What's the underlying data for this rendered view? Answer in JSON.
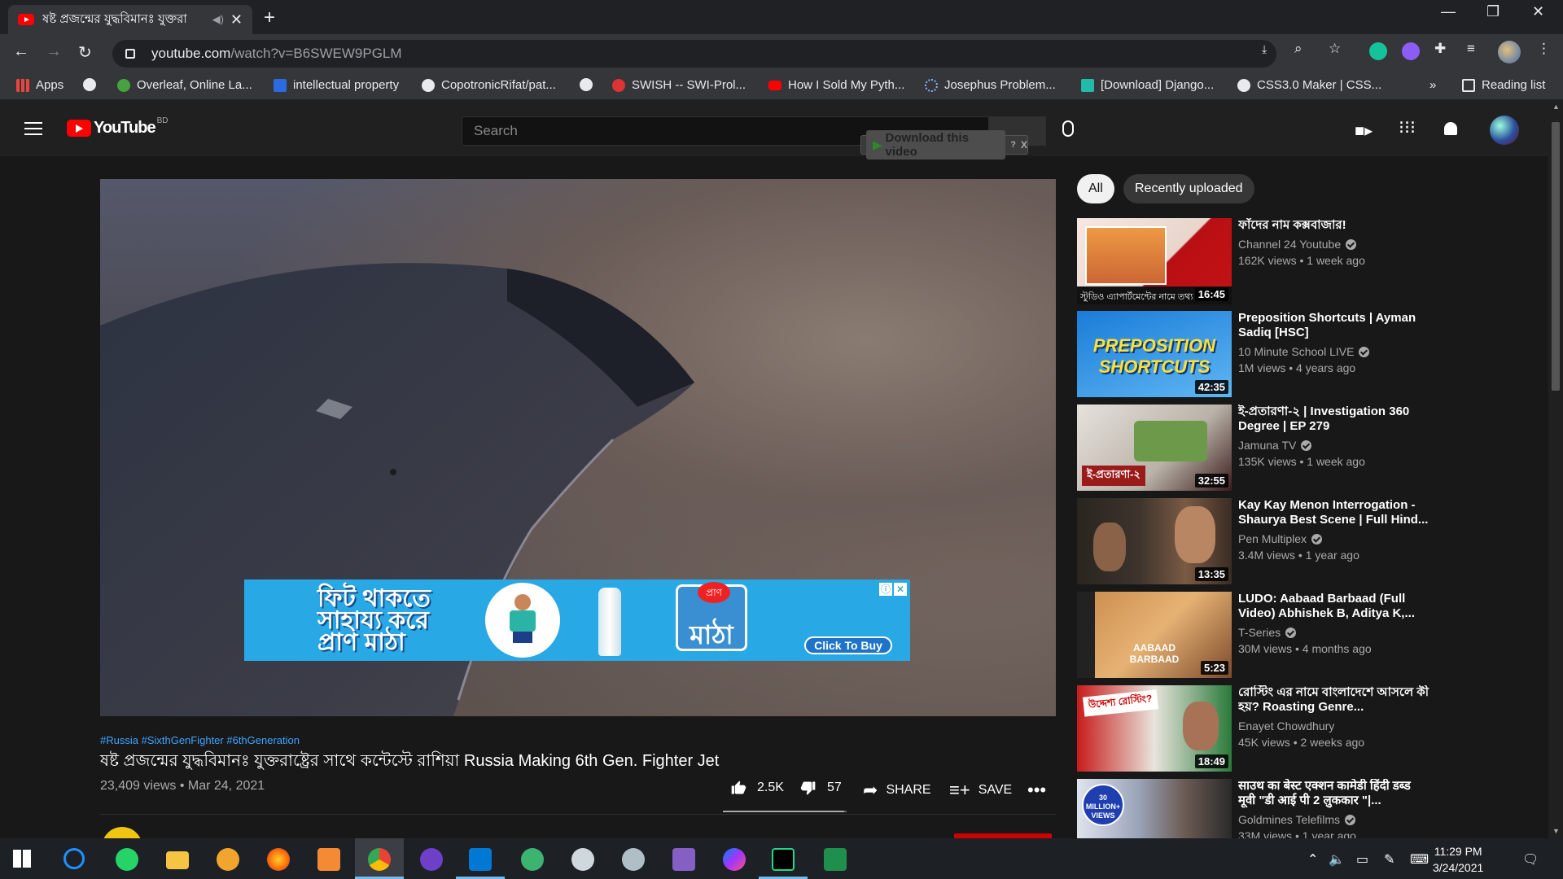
{
  "browser": {
    "tab_title": "ষষ্ট প্রজন্মের যুদ্ধবিমানঃ যুক্তরা",
    "url_host": "youtube.com",
    "url_path": "/watch?v=B6SWEW9PGLM",
    "bookmarks": [
      {
        "label": "Apps",
        "icon": "apps-grid-icon",
        "color": "#e8453c"
      },
      {
        "label": "",
        "icon": "globe-icon",
        "color": "#e8eaed"
      },
      {
        "label": "Overleaf, Online La...",
        "icon": "overleaf-icon",
        "color": "#47a141"
      },
      {
        "label": "intellectual property",
        "icon": "s-icon",
        "color": "#2b6be0"
      },
      {
        "label": "CopotronicRifat/pat...",
        "icon": "github-icon",
        "color": "#e8eaed"
      },
      {
        "label": "",
        "icon": "globe-icon",
        "color": "#e8eaed"
      },
      {
        "label": "SWISH -- SWI-Prol...",
        "icon": "swish-icon",
        "color": "#d33"
      },
      {
        "label": "How I Sold My Pyth...",
        "icon": "youtube-icon",
        "color": "#ff0000"
      },
      {
        "label": "Josephus Problem...",
        "icon": "loading-icon",
        "color": "#8ab4f8"
      },
      {
        "label": "[Download] Django...",
        "icon": "django-icon",
        "color": "#2ba"
      },
      {
        "label": "CSS3.0 Maker | CSS...",
        "icon": "globe-icon",
        "color": "#e8eaed"
      }
    ],
    "overflow": "»",
    "reading_list": "Reading list"
  },
  "youtube": {
    "region": "BD",
    "search_placeholder": "Search",
    "download_label": "Download this video",
    "download_help": "?",
    "download_close": "X",
    "chips": [
      "All",
      "Recently uploaded"
    ],
    "video": {
      "hashtags": "#Russia #SixthGenFighter #6thGeneration",
      "title": "ষষ্ট প্রজন্মের যুদ্ধবিমানঃ যুক্তরাষ্ট্রের সাথে কন্টেস্টে রাশিয়া Russia Making 6th Gen. Fighter Jet",
      "views_date": "23,409 views • Mar 24, 2021",
      "likes": "2.5K",
      "dislikes": "57",
      "share": "SHARE",
      "save": "SAVE",
      "like_ratio": 0.98
    },
    "ad": {
      "line1": "ফিট থাকতে",
      "line2": "সাহায্য করে",
      "line3": "প্রাণ মাঠা",
      "brand": "প্রাণ",
      "product": "মাঠা",
      "cta": "Click To Buy"
    },
    "related": [
      {
        "title": "ফাঁদের নাম কক্সবাজার!",
        "channel": "Channel 24 Youtube",
        "verified": true,
        "meta": "162K views • 1 week ago",
        "duration": "16:45",
        "thumb_text": "স্টুডিও এ্যাপার্টমেন্টের নামে তথ্য"
      },
      {
        "title": "Preposition Shortcuts | Ayman Sadiq [HSC]",
        "channel": "10 Minute School LIVE",
        "verified": true,
        "meta": "1M views • 4 years ago",
        "duration": "42:35",
        "thumb_text": "PREPOSITION SHORTCUTS"
      },
      {
        "title": "ই-প্রতারণা-২ | Investigation 360 Degree | EP 279",
        "channel": "Jamuna TV",
        "verified": true,
        "meta": "135K views • 1 week ago",
        "duration": "32:55",
        "thumb_text": "ই-প্রতারণা-২"
      },
      {
        "title": "Kay Kay Menon Interrogation - Shaurya Best Scene | Full Hind...",
        "channel": "Pen Multiplex",
        "verified": true,
        "meta": "3.4M views • 1 year ago",
        "duration": "13:35",
        "thumb_text": ""
      },
      {
        "title": "LUDO: Aabaad Barbaad (Full Video) Abhishek B, Aditya K,...",
        "channel": "T-Series",
        "verified": true,
        "meta": "30M views • 4 months ago",
        "duration": "5:23",
        "thumb_text": "AABAAD BARBAAD"
      },
      {
        "title": "রোস্টিং এর নামে বাংলাদেশে আসলে কী হয়? Roasting Genre...",
        "channel": "Enayet Chowdhury",
        "verified": false,
        "meta": "45K views • 2 weeks ago",
        "duration": "18:49",
        "thumb_text": "উদ্দেশ্য রোস্টিং?"
      },
      {
        "title": "साउथ का बेस्ट एक्शन कामेडी हिंदी डब्ड मूवी \"डी आई पी 2 लुककार \"|...",
        "channel": "Goldmines Telefilms",
        "verified": true,
        "meta": "33M views • 1 year ago",
        "duration": "",
        "thumb_text": "30 MILLION+ VIEWS"
      }
    ]
  },
  "taskbar": {
    "time": "11:29 PM",
    "date": "3/24/2021"
  }
}
